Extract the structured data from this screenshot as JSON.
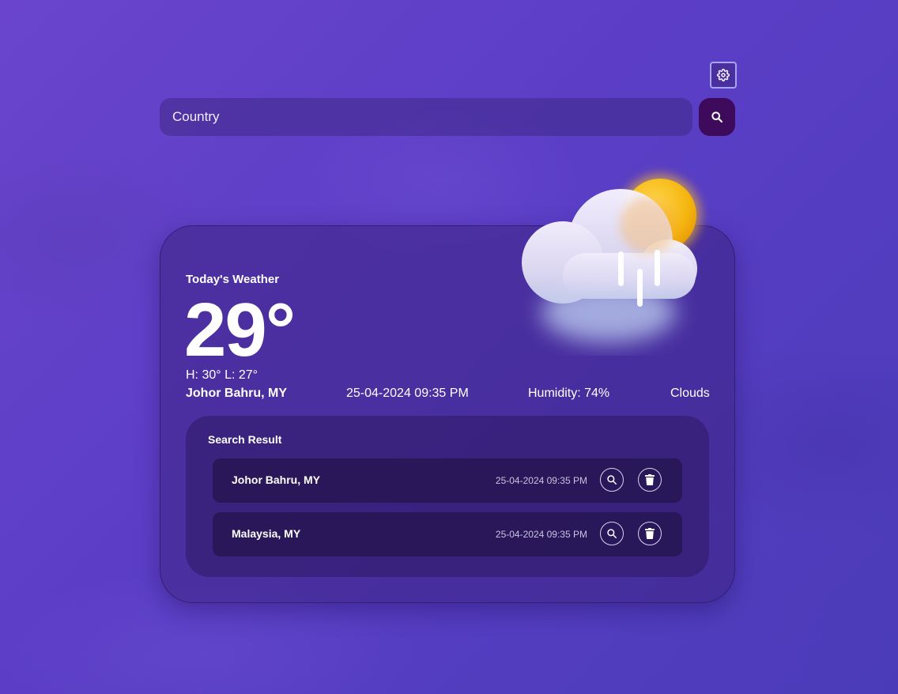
{
  "search": {
    "placeholder": "Country"
  },
  "icons": {
    "settings": "gear-icon",
    "search": "search-icon",
    "delete": "trash-icon",
    "weather": "cloud-sun-rain-icon"
  },
  "weather": {
    "title": "Today's Weather",
    "temperature": "29°",
    "high_low": "H: 30° L: 27°",
    "location": "Johor Bahru, MY",
    "datetime": "25-04-2024 09:35 PM",
    "humidity": "Humidity: 74%",
    "condition": "Clouds"
  },
  "results": {
    "title": "Search Result",
    "items": [
      {
        "name": "Johor Bahru, MY",
        "time": "25-04-2024 09:35 PM"
      },
      {
        "name": "Malaysia, MY",
        "time": "25-04-2024 09:35 PM"
      }
    ]
  },
  "colors": {
    "background": "#5b3ec6",
    "search_button": "#3d0a5c",
    "sun": "#f5b50f"
  }
}
